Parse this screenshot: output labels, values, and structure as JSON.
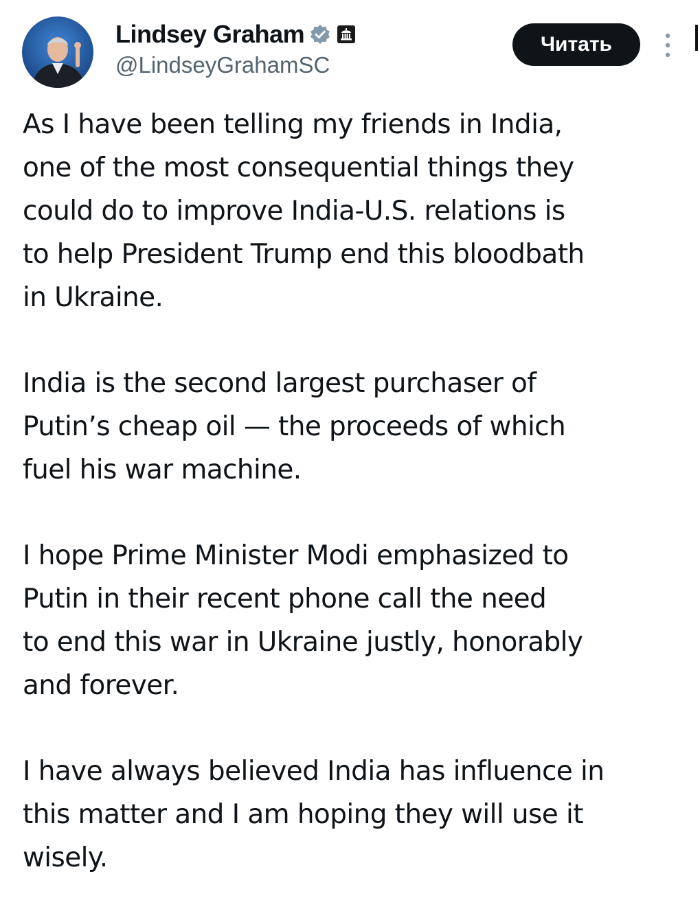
{
  "author": {
    "display_name": "Lindsey Graham",
    "handle": "@LindseyGrahamSC",
    "verified_color": "#829aab",
    "avatar_icon": "avatar-photo"
  },
  "actions": {
    "read_label": "Читать",
    "more_icon": "vertical-ellipsis"
  },
  "tweet": {
    "paragraphs": [
      {
        "lines": [
          "As I have been telling my friends in India,",
          "one of the most consequential things they",
          "could do to improve India-U.S. relations is",
          "to help President Trump end this bloodbath",
          "in Ukraine."
        ]
      },
      {
        "lines": [
          "India is the second largest purchaser of",
          "Putin’s cheap oil — the proceeds of which",
          "fuel his war machine."
        ]
      },
      {
        "lines": [
          "I hope Prime Minister Modi emphasized to",
          "Putin in their recent phone call the need",
          "to end this war in Ukraine justly, honorably",
          "and forever."
        ]
      },
      {
        "lines": [
          "I have always believed India has influence in",
          "this matter and I am hoping they will use it",
          "wisely."
        ]
      }
    ]
  }
}
